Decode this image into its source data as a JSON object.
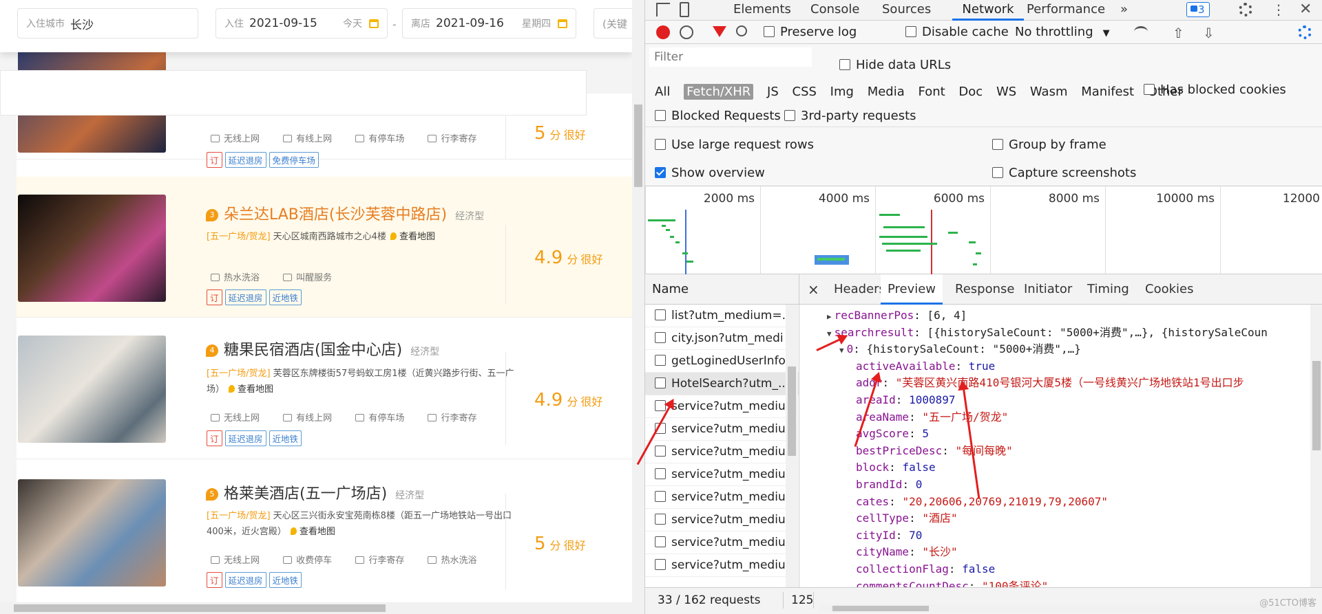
{
  "page": {
    "search": {
      "city_label": "入住城市",
      "city_value": "长沙",
      "checkin_label": "入住",
      "checkin_date": "2021-09-15",
      "checkin_hint": "今天",
      "dash": "-",
      "checkout_label": "离店",
      "checkout_date": "2021-09-16",
      "checkout_hint": "星期四",
      "keyword_placeholder": "(关键"
    },
    "hotels": [
      {
        "rank": "",
        "name": "",
        "type": "",
        "area": "",
        "address": "",
        "map_link": "",
        "facilities": [
          "无线上网",
          "有线上网",
          "有停车场",
          "行李寄存"
        ],
        "tags": [
          "订",
          "延迟退房",
          "免费停车场"
        ],
        "score": "5",
        "score_unit": "分",
        "score_word": "很好"
      },
      {
        "rank": "3",
        "name": "朵兰达LAB酒店(长沙芙蓉中路店)",
        "type": "经济型",
        "area": "[五一广场/贺龙]",
        "address": "天心区城南西路城市之心4楼",
        "map_link": "查看地图",
        "facilities": [
          "热水洗浴",
          "叫醒服务"
        ],
        "tags": [
          "订",
          "延迟退房",
          "近地铁"
        ],
        "score": "4.9",
        "score_unit": "分",
        "score_word": "很好"
      },
      {
        "rank": "4",
        "name": "糖果民宿酒店(国金中心店)",
        "type": "经济型",
        "area": "[五一广场/贺龙]",
        "address": "芙蓉区东牌楼街57号蚂蚁工房1楼（近黄兴路步行街、五一广场）",
        "map_link": "查看地图",
        "facilities": [
          "无线上网",
          "有线上网",
          "有停车场",
          "行李寄存"
        ],
        "tags": [
          "订",
          "延迟退房",
          "近地铁"
        ],
        "score": "4.9",
        "score_unit": "分",
        "score_word": "很好"
      },
      {
        "rank": "5",
        "name": "格莱美酒店(五一广场店)",
        "type": "经济型",
        "area": "[五一广场/贺龙]",
        "address": "天心区三兴街永安宝苑南栋8楼（距五一广场地铁站一号出口400米，近火宫殿）",
        "map_link": "查看地图",
        "facilities": [
          "无线上网",
          "收费停车",
          "行李寄存",
          "热水洗浴"
        ],
        "tags": [
          "订",
          "延迟退房",
          "近地铁"
        ],
        "score": "5",
        "score_unit": "分",
        "score_word": "很好"
      }
    ]
  },
  "devtools": {
    "tabs": [
      "Elements",
      "Console",
      "Sources",
      "Network",
      "Performance"
    ],
    "more": "»",
    "issues_count": "3",
    "toolbar": {
      "preserve_log": "Preserve log",
      "disable_cache": "Disable cache",
      "throttling": "No throttling"
    },
    "filter_placeholder": "Filter",
    "hide_data_urls": "Hide data URLs",
    "type_filters": [
      "All",
      "Fetch/XHR",
      "JS",
      "CSS",
      "Img",
      "Media",
      "Font",
      "Doc",
      "WS",
      "Wasm",
      "Manifest",
      "Other"
    ],
    "has_blocked_cookies": "Has blocked cookies",
    "blocked_requests": "Blocked Requests",
    "third_party": "3rd-party requests",
    "large_rows": "Use large request rows",
    "group_by_frame": "Group by frame",
    "show_overview": "Show overview",
    "capture_screenshots": "Capture screenshots",
    "timeline_ticks": [
      "2000 ms",
      "4000 ms",
      "6000 ms",
      "8000 ms",
      "10000 ms",
      "12000"
    ],
    "name_header": "Name",
    "requests": [
      "list?utm_medium=...",
      "city.json?utm_medi",
      "getLoginedUserInfo",
      "HotelSearch?utm_...",
      "service?utm_mediu",
      "service?utm_mediu",
      "service?utm_mediu",
      "service?utm_mediu",
      "service?utm_mediu",
      "service?utm_mediu",
      "service?utm_mediu",
      "service?utm_mediu"
    ],
    "detail_close": "×",
    "detail_tabs": [
      "Headers",
      "Preview",
      "Response",
      "Initiator",
      "Timing",
      "Cookies"
    ],
    "preview_lines": [
      {
        "indent": 0,
        "tri": "▶",
        "key": "recBannerPos",
        "val": "[6, 4]",
        "vt": "p"
      },
      {
        "indent": 0,
        "tri": "▼",
        "key": "searchresult",
        "val": "[{historySaleCount: \"5000+消费\",…}, {historySaleCoun",
        "vt": "p"
      },
      {
        "indent": 1,
        "tri": "▼",
        "key": "0",
        "val": "{historySaleCount: \"5000+消费\",…}",
        "vt": "p"
      },
      {
        "indent": 2,
        "tri": "",
        "key": "activeAvailable",
        "val": "true",
        "vt": "n"
      },
      {
        "indent": 2,
        "tri": "",
        "key": "addr",
        "val": "\"芙蓉区黄兴南路410号银河大厦5楼（一号线黄兴广场地铁站1号出口步",
        "vt": "s"
      },
      {
        "indent": 2,
        "tri": "",
        "key": "areaId",
        "val": "1000897",
        "vt": "n"
      },
      {
        "indent": 2,
        "tri": "",
        "key": "areaName",
        "val": "\"五一广场/贺龙\"",
        "vt": "s"
      },
      {
        "indent": 2,
        "tri": "",
        "key": "avgScore",
        "val": "5",
        "vt": "n"
      },
      {
        "indent": 2,
        "tri": "",
        "key": "bestPriceDesc",
        "val": "\"每间每晚\"",
        "vt": "s"
      },
      {
        "indent": 2,
        "tri": "",
        "key": "block",
        "val": "false",
        "vt": "n"
      },
      {
        "indent": 2,
        "tri": "",
        "key": "brandId",
        "val": "0",
        "vt": "n"
      },
      {
        "indent": 2,
        "tri": "",
        "key": "cates",
        "val": "\"20,20606,20769,21019,79,20607\"",
        "vt": "s"
      },
      {
        "indent": 2,
        "tri": "",
        "key": "cellType",
        "val": "\"酒店\"",
        "vt": "s"
      },
      {
        "indent": 2,
        "tri": "",
        "key": "cityId",
        "val": "70",
        "vt": "n"
      },
      {
        "indent": 2,
        "tri": "",
        "key": "cityName",
        "val": "\"长沙\"",
        "vt": "s"
      },
      {
        "indent": 2,
        "tri": "",
        "key": "collectionFlag",
        "val": "false",
        "vt": "n"
      },
      {
        "indent": 2,
        "tri": "",
        "key": "commentsCountDesc",
        "val": "\"100条评论\"",
        "vt": "s"
      }
    ],
    "status": {
      "requests": "33 / 162 requests",
      "transferred": "125"
    },
    "watermark": "@51CTO博客"
  }
}
